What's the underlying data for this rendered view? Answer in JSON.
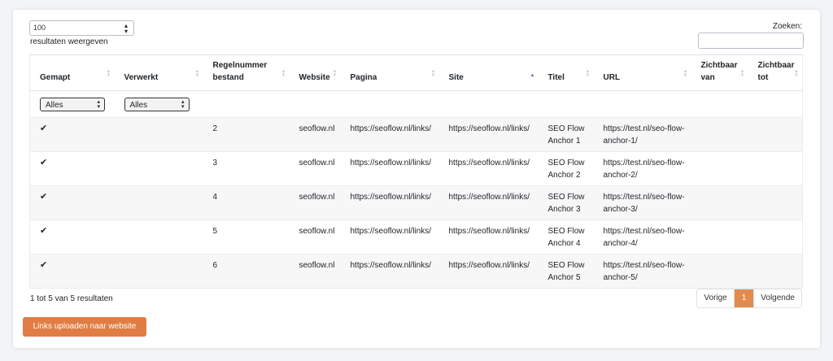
{
  "controls": {
    "length_value": "100",
    "length_label": "resultaten weergeven",
    "search_label": "Zoeken:",
    "search_value": ""
  },
  "columns": [
    {
      "label": "Gemapt",
      "sorted": false
    },
    {
      "label": "Verwerkt",
      "sorted": false
    },
    {
      "label": "Regelnummer bestand",
      "sorted": false
    },
    {
      "label": "Website",
      "sorted": false
    },
    {
      "label": "Pagina",
      "sorted": false
    },
    {
      "label": "Site",
      "sorted": true
    },
    {
      "label": "Titel",
      "sorted": false
    },
    {
      "label": "URL",
      "sorted": false
    },
    {
      "label": "Zichtbaar van",
      "sorted": false
    },
    {
      "label": "Zichtbaar tot",
      "sorted": false
    }
  ],
  "filters": {
    "gemapt": "Alles",
    "verwerkt": "Alles"
  },
  "rows": [
    {
      "gemapt": "✔",
      "verwerkt": "",
      "regel": "2",
      "website": "seoflow.nl",
      "pagina": "https://seoflow.nl/links/",
      "site": "https://seoflow.nl/links/",
      "titel": "SEO Flow Anchor 1",
      "url": "https://test.nl/seo-flow-anchor-1/",
      "van": "",
      "tot": ""
    },
    {
      "gemapt": "✔",
      "verwerkt": "",
      "regel": "3",
      "website": "seoflow.nl",
      "pagina": "https://seoflow.nl/links/",
      "site": "https://seoflow.nl/links/",
      "titel": "SEO Flow Anchor 2",
      "url": "https://test.nl/seo-flow-anchor-2/",
      "van": "",
      "tot": ""
    },
    {
      "gemapt": "✔",
      "verwerkt": "",
      "regel": "4",
      "website": "seoflow.nl",
      "pagina": "https://seoflow.nl/links/",
      "site": "https://seoflow.nl/links/",
      "titel": "SEO Flow Anchor 3",
      "url": "https://test.nl/seo-flow-anchor-3/",
      "van": "",
      "tot": ""
    },
    {
      "gemapt": "✔",
      "verwerkt": "",
      "regel": "5",
      "website": "seoflow.nl",
      "pagina": "https://seoflow.nl/links/",
      "site": "https://seoflow.nl/links/",
      "titel": "SEO Flow Anchor 4",
      "url": "https://test.nl/seo-flow-anchor-4/",
      "van": "",
      "tot": ""
    },
    {
      "gemapt": "✔",
      "verwerkt": "",
      "regel": "6",
      "website": "seoflow.nl",
      "pagina": "https://seoflow.nl/links/",
      "site": "https://seoflow.nl/links/",
      "titel": "SEO Flow Anchor 5",
      "url": "https://test.nl/seo-flow-anchor-5/",
      "van": "",
      "tot": ""
    }
  ],
  "footer": {
    "info": "1 tot 5 van 5 resultaten",
    "prev": "Vorige",
    "page": "1",
    "next": "Volgende",
    "upload_button": "Links uploaden naar website"
  },
  "colors": {
    "accent": "#e07d44",
    "active_page": "#e38b4f",
    "sort_active": "#6d5fb5"
  }
}
